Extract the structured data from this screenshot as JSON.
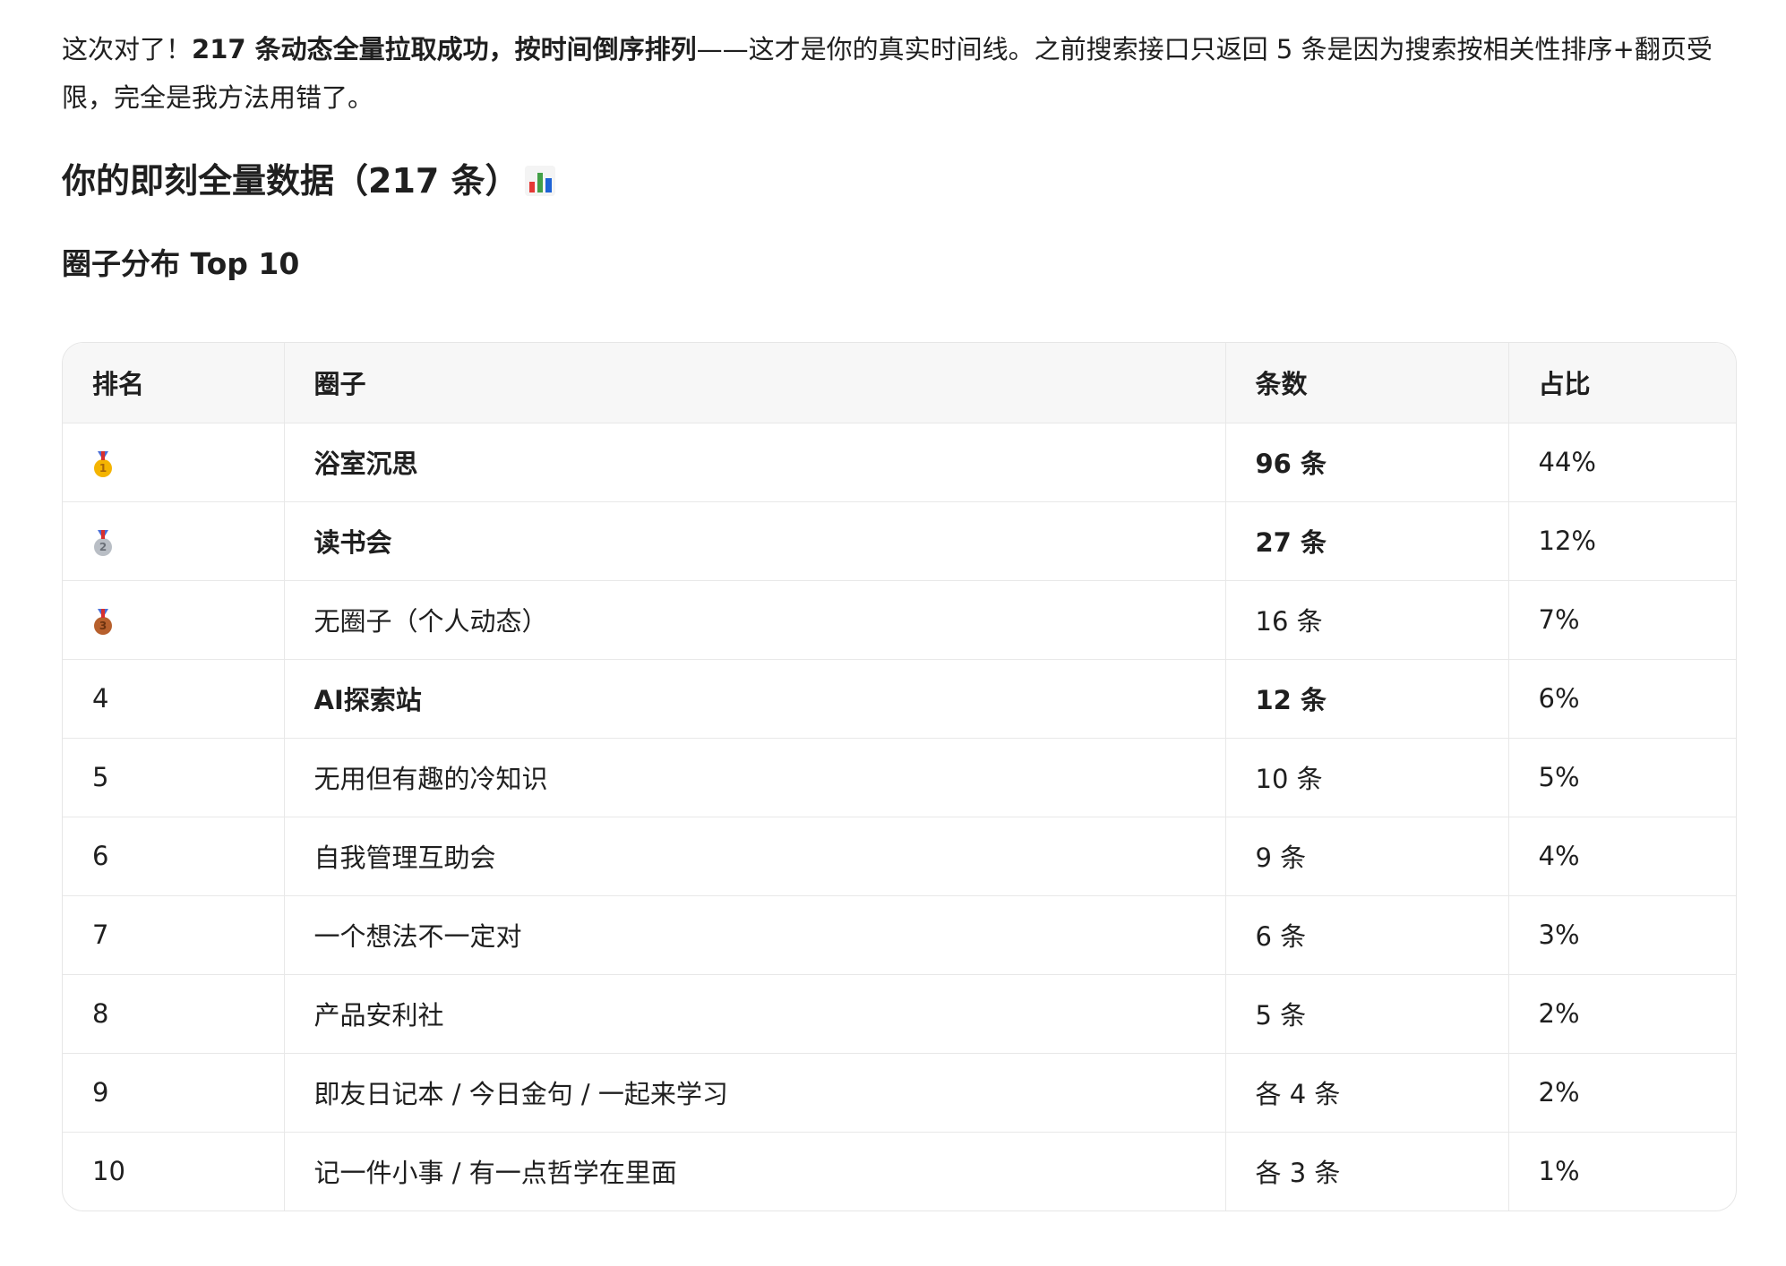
{
  "intro": {
    "lead": "这次对了！",
    "bold": "217 条动态全量拉取成功，按时间倒序排列",
    "rest": "——这才是你的真实时间线。之前搜索接口只返回 5 条是因为搜索按相关性排序+翻页受限，完全是我方法用错了。"
  },
  "heading": {
    "title": "你的即刻全量数据（217 条）",
    "emoji_icon": "bar-chart-icon"
  },
  "subheading": "圈子分布 Top 10",
  "table": {
    "headers": [
      "排名",
      "圈子",
      "条数",
      "占比"
    ],
    "rows": [
      {
        "rank": "1",
        "medal": "gold",
        "circle": "浴室沉思",
        "count": "96 条",
        "share": "44%",
        "bold": true
      },
      {
        "rank": "2",
        "medal": "silver",
        "circle": "读书会",
        "count": "27 条",
        "share": "12%",
        "bold": true
      },
      {
        "rank": "3",
        "medal": "bronze",
        "circle": "无圈子（个人动态）",
        "count": "16 条",
        "share": "7%",
        "bold": false
      },
      {
        "rank": "4",
        "medal": "",
        "circle": "AI探索站",
        "count": "12 条",
        "share": "6%",
        "bold": true
      },
      {
        "rank": "5",
        "medal": "",
        "circle": "无用但有趣的冷知识",
        "count": "10 条",
        "share": "5%",
        "bold": false
      },
      {
        "rank": "6",
        "medal": "",
        "circle": "自我管理互助会",
        "count": "9 条",
        "share": "4%",
        "bold": false
      },
      {
        "rank": "7",
        "medal": "",
        "circle": "一个想法不一定对",
        "count": "6 条",
        "share": "3%",
        "bold": false
      },
      {
        "rank": "8",
        "medal": "",
        "circle": "产品安利社",
        "count": "5 条",
        "share": "2%",
        "bold": false
      },
      {
        "rank": "9",
        "medal": "",
        "circle": "即友日记本 / 今日金句 / 一起来学习",
        "count": "各 4 条",
        "share": "2%",
        "bold": false
      },
      {
        "rank": "10",
        "medal": "",
        "circle": "记一件小事 / 有一点哲学在里面",
        "count": "各 3 条",
        "share": "1%",
        "bold": false
      }
    ]
  }
}
